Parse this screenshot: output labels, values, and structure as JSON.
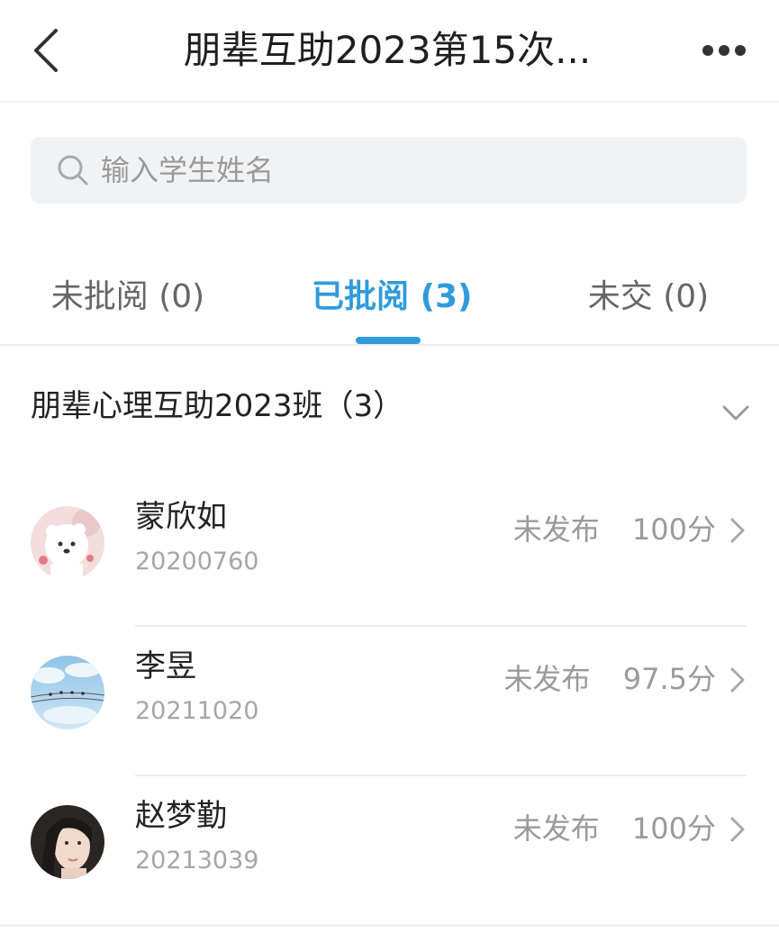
{
  "header": {
    "title": "朋辈互助2023第15次...",
    "back_icon": "chevron-left-icon",
    "more_icon": "more-dots-icon"
  },
  "search": {
    "placeholder": "输入学生姓名",
    "value": "",
    "icon": "search-icon"
  },
  "tabs": [
    {
      "label": "未批阅 (0)",
      "active": false
    },
    {
      "label": "已批阅 (3)",
      "active": true
    },
    {
      "label": "未交 (0)",
      "active": false
    }
  ],
  "class_group": {
    "name": "朋辈心理互助2023班（3）",
    "expand_icon": "chevron-down-icon"
  },
  "students": [
    {
      "name": "蒙欣如",
      "id": "20200760",
      "status": "未发布",
      "score": "100分",
      "avatar": "avatar-bear"
    },
    {
      "name": "李昱",
      "id": "20211020",
      "status": "未发布",
      "score": "97.5分",
      "avatar": "avatar-sky"
    },
    {
      "name": "赵梦勤",
      "id": "20213039",
      "status": "未发布",
      "score": "100分",
      "avatar": "avatar-portrait"
    }
  ],
  "colors": {
    "accent": "#2f9bdc",
    "text_primary": "#222222",
    "text_secondary": "#9a9a9a",
    "search_bg": "#f1f2f4"
  }
}
